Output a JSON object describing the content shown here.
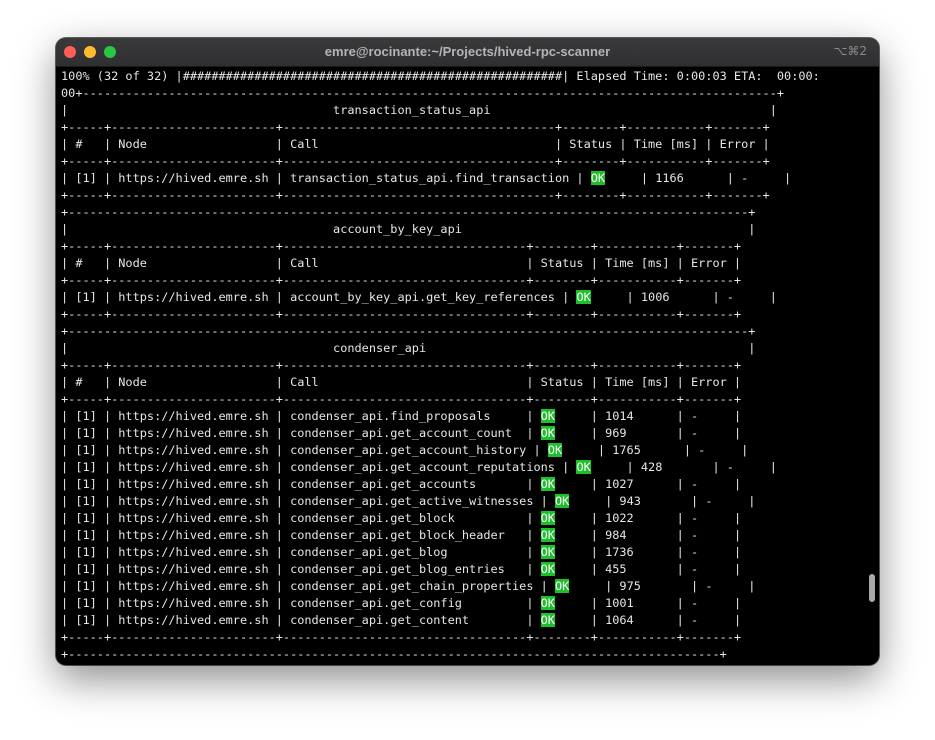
{
  "window": {
    "title": "emre@rocinante:~/Projects/hived-rpc-scanner",
    "shortcut": "⌥⌘2"
  },
  "terminal": {
    "lines": [
      "100% (32 of 32) |#####################################################| Elapsed Time: 0:00:03 ETA:  00:00:",
      "00+-------------------------------------------------------------------------------------------------+",
      "|                                     transaction_status_api                                       |",
      "+-----+-----------------------+--------------------------------------+--------+-----------+-------+",
      "| #   | Node                  | Call                                 | Status | Time [ms] | Error |",
      "+-----+-----------------------+--------------------------------------+--------+-----------+-------+",
      "| [1] | https://hived.emre.sh | transaction_status_api.find_transaction | OK     | 1166      | -     |",
      "+-----+-----------------------+--------------------------------------+--------+-----------+-------+",
      "+-----------------------------------------------------------------------------------------------+",
      "|                                     account_by_key_api                                        |",
      "+-----+-----------------------+----------------------------------+--------+-----------+-------+",
      "| #   | Node                  | Call                             | Status | Time [ms] | Error |",
      "+-----+-----------------------+----------------------------------+--------+-----------+-------+",
      "| [1] | https://hived.emre.sh | account_by_key_api.get_key_references | OK     | 1006      | -     |",
      "+-----+-----------------------+----------------------------------+--------+-----------+-------+",
      "+-----------------------------------------------------------------------------------------------+",
      "|                                     condenser_api                                             |",
      "+-----+-----------------------+----------------------------------+--------+-----------+-------+",
      "| #   | Node                  | Call                             | Status | Time [ms] | Error |",
      "+-----+-----------------------+----------------------------------+--------+-----------+-------+",
      "| [1] | https://hived.emre.sh | condenser_api.find_proposals     | OK     | 1014      | -     |",
      "| [1] | https://hived.emre.sh | condenser_api.get_account_count  | OK     | 969       | -     |",
      "| [1] | https://hived.emre.sh | condenser_api.get_account_history | OK     | 1765      | -     |",
      "| [1] | https://hived.emre.sh | condenser_api.get_account_reputations | OK     | 428       | -     |",
      "| [1] | https://hived.emre.sh | condenser_api.get_accounts       | OK     | 1027      | -     |",
      "| [1] | https://hived.emre.sh | condenser_api.get_active_witnesses | OK     | 943       | -     |",
      "| [1] | https://hived.emre.sh | condenser_api.get_block          | OK     | 1022      | -     |",
      "| [1] | https://hived.emre.sh | condenser_api.get_block_header   | OK     | 984       | -     |",
      "| [1] | https://hived.emre.sh | condenser_api.get_blog           | OK     | 1736      | -     |",
      "| [1] | https://hived.emre.sh | condenser_api.get_blog_entries   | OK     | 455       | -     |",
      "| [1] | https://hived.emre.sh | condenser_api.get_chain_properties | OK     | 975       | -     |",
      "| [1] | https://hived.emre.sh | condenser_api.get_config         | OK     | 1001      | -     |",
      "| [1] | https://hived.emre.sh | condenser_api.get_content        | OK     | 1064      | -     |",
      "+-----+-----------------------+----------------------------------+--------+-----------+-------+",
      "+-------------------------------------------------------------------------------------------+"
    ]
  },
  "colors": {
    "ok_background": "#1dbf2a",
    "terminal_background": "#000000",
    "terminal_text": "#e6e6e6"
  }
}
